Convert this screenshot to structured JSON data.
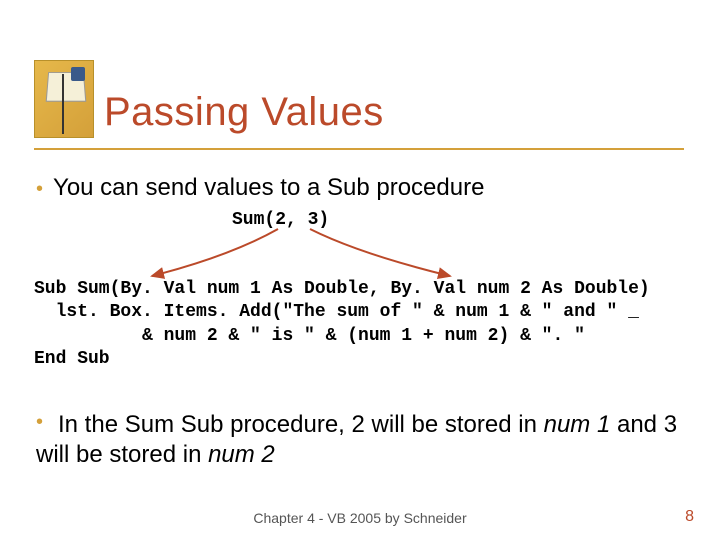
{
  "title": "Passing Values",
  "bullet1": "You can send values to a Sub procedure",
  "sum_call": "Sum(2, 3)",
  "code": {
    "l1": "Sub Sum(By. Val num 1 As Double, By. Val num 2 As Double)",
    "l2": "  lst. Box. Items. Add(\"The sum of \" & num 1 & \" and \" _",
    "l3": "          & num 2 & \" is \" & (num 1 + num 2) & \". \"",
    "l4": "End Sub"
  },
  "bullet2": {
    "pre": "In the Sum Sub procedure, 2 will be stored in ",
    "em1": "num 1",
    "mid": " and 3 will be stored in ",
    "em2": "num 2"
  },
  "footer": "Chapter 4 - VB 2005 by Schneider",
  "page_number": "8"
}
